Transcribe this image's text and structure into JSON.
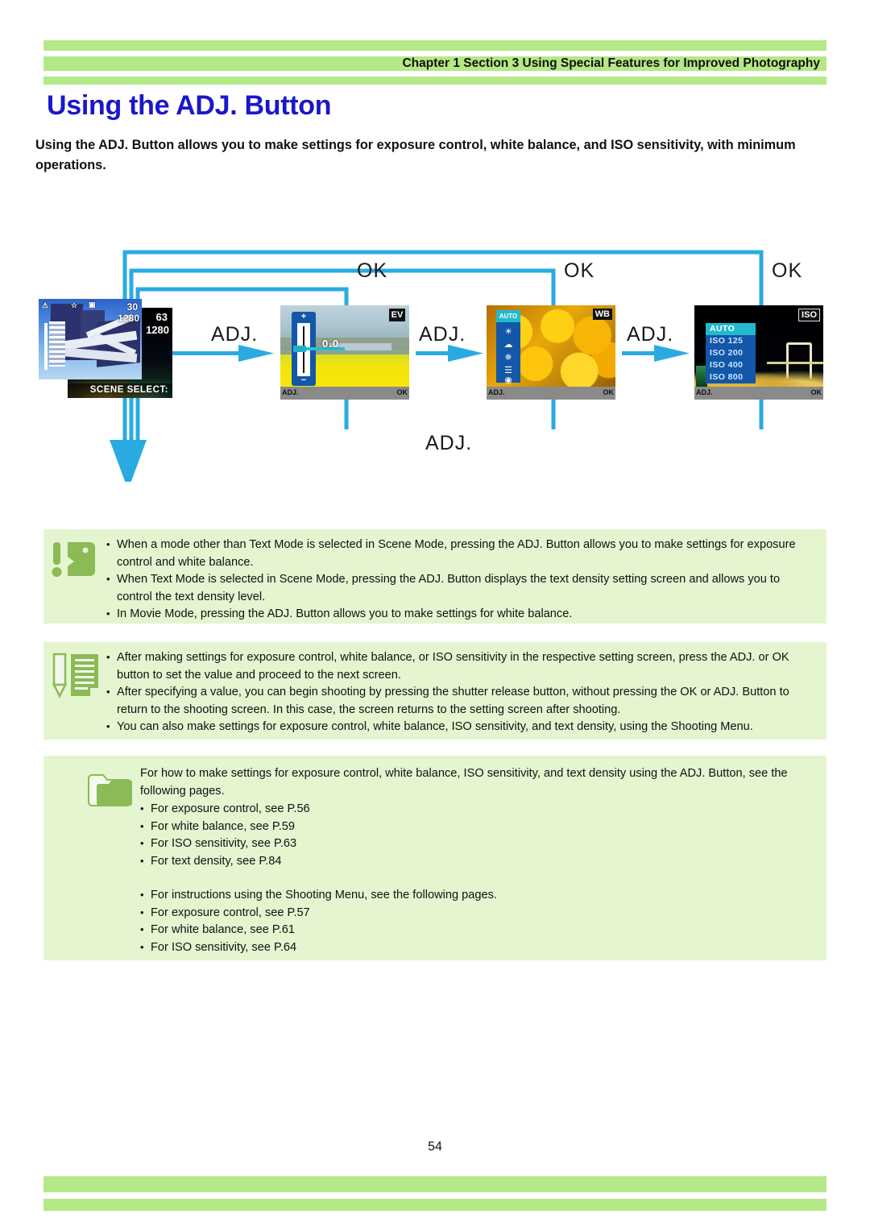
{
  "header": {
    "breadcrumb": "Chapter 1 Section 3 Using Special Features for Improved Photography",
    "band_color": "#b5e887"
  },
  "title": {
    "text": "Using the ADJ. Button",
    "color": "#1b17c8"
  },
  "lead": "Using the ADJ. Button allows you to make settings for exposure control, white balance, and ISO sensitivity, with minimum operations.",
  "diagram": {
    "accent_color": "#29abe2",
    "labels": {
      "adj1": "ADJ.",
      "adj2": "ADJ.",
      "adj3": "ADJ.",
      "ok1": "OK",
      "ok2": "OK",
      "ok3": "OK",
      "adj_return": "ADJ."
    },
    "screens": {
      "shooting": {
        "name": "shooting-screen",
        "counter": "30",
        "resolution": "1280",
        "back_counter": "63",
        "back_resolution": "1280",
        "bottom_text": "SCENE SELECT:"
      },
      "exposure": {
        "name": "exposure-compensation-screen",
        "value": "0.0",
        "plus": "+",
        "minus": "−",
        "badge": "EV",
        "left_hint": "ADJ.",
        "right_hint": "OK"
      },
      "white_balance": {
        "name": "white-balance-screen",
        "badge": "WB",
        "selected": "AUTO",
        "options": [
          "AUTO",
          "Daylight",
          "Overcast",
          "Tungsten",
          "Fluorescent",
          "Manual"
        ],
        "left_hint": "ADJ.",
        "right_hint": "OK"
      },
      "iso": {
        "name": "iso-sensitivity-screen",
        "badge": "ISO",
        "selected": "AUTO",
        "options": [
          "AUTO",
          "ISO 125",
          "ISO 200",
          "ISO 400",
          "ISO 800"
        ],
        "left_hint": "ADJ.",
        "right_hint": "OK"
      }
    }
  },
  "notes": {
    "caution": {
      "icon": "caution-icon",
      "items": [
        "When a mode other than Text Mode is selected in Scene Mode, pressing the ADJ. Button allows you to make settings for exposure control and white balance.",
        "When Text Mode is selected in Scene Mode, pressing the ADJ. Button displays the text density setting screen and allows you to control the text density level.",
        "In Movie Mode, pressing the ADJ. Button allows you to make settings for white balance."
      ]
    },
    "memo": {
      "icon": "memo-note-icon",
      "items": [
        "After making settings for exposure control, white balance, or ISO sensitivity in the respective setting screen, press the ADJ. or OK button to set the value and proceed to the next screen.",
        "After specifying a value, you can begin shooting by pressing the shutter release button, without pressing the OK or ADJ. Button to return to the shooting screen. In this case, the screen returns to the setting screen after shooting.",
        "You can also make settings for exposure control, white balance, ISO sensitivity, and text density, using the Shooting Menu."
      ]
    },
    "reference": {
      "icon": "folder-reference-icon",
      "intro": "For how to make settings for exposure control, white balance, ISO sensitivity, and text density using the ADJ. Button, see the following pages.",
      "group1": [
        "For exposure control, see P.56",
        "For white balance, see P.59",
        "For ISO sensitivity, see P.63",
        "For text density, see P.84"
      ],
      "group2": [
        "For instructions using the Shooting Menu, see the following pages.",
        "For exposure control, see P.57",
        "For white balance, see P.61",
        "For ISO sensitivity, see P.64"
      ]
    }
  },
  "footer": {
    "page_number": "54"
  }
}
